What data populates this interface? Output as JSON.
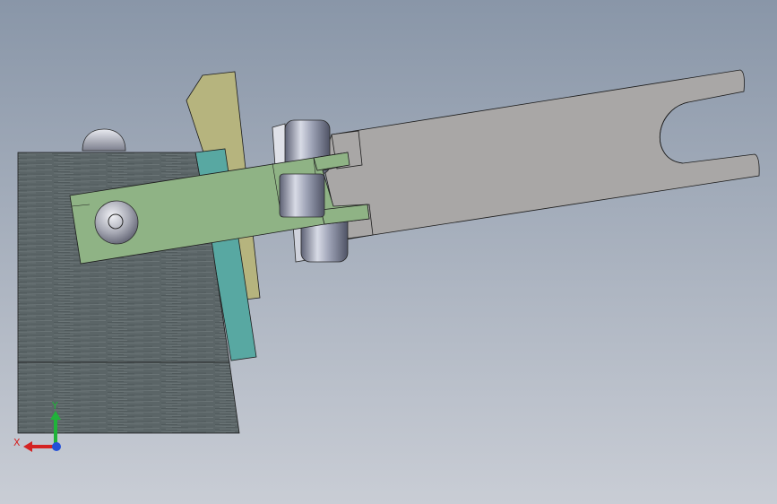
{
  "viewport": {
    "background_top": "#8996a8",
    "background_bottom": "#c9cdd5"
  },
  "parts": {
    "base_block_color": "#5b6567",
    "yellow_plate_color": "#b6b47e",
    "cyan_spacer_color": "#58a8a2",
    "green_arm_color": "#8fb385",
    "gray_fork_color": "#a9a7a6",
    "pin_color": "#a2a7ba",
    "edge_color": "#1c1c1c"
  },
  "triad": {
    "x_label": "X",
    "y_label": "Y",
    "x_color": "#d42323",
    "y_color": "#20b33a",
    "z_color": "#2450d8"
  }
}
